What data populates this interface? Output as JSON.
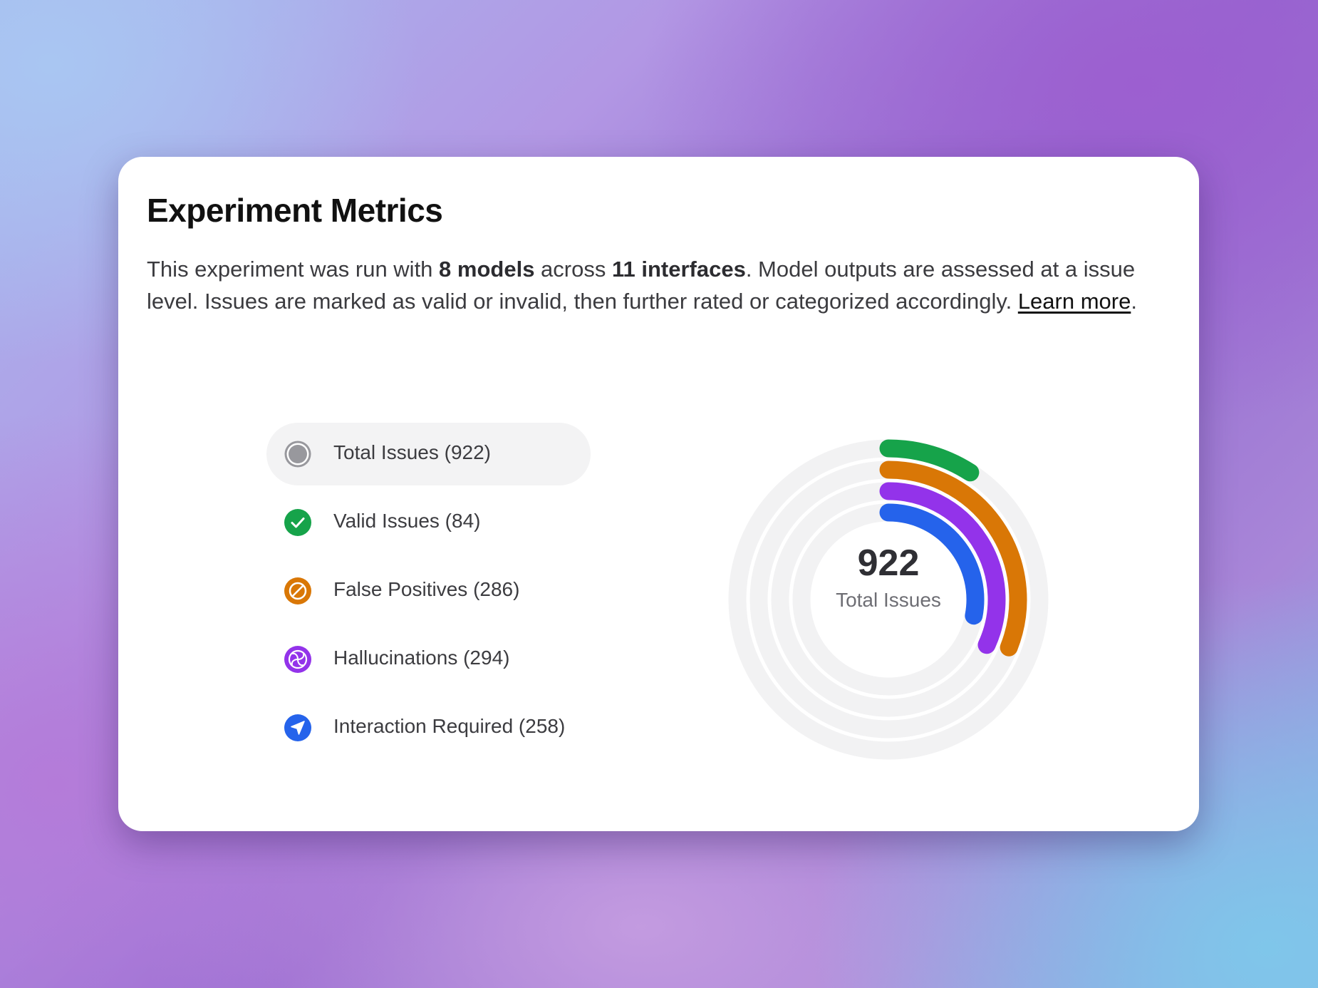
{
  "card": {
    "title": "Experiment Metrics",
    "desc_1": "This experiment was run with ",
    "desc_models": "8 models",
    "desc_2": " across ",
    "desc_interfaces": "11 interfaces",
    "desc_3": ". Model outputs are assessed at a issue level. Issues are marked as valid or invalid, then further rated or categorized accordingly. ",
    "learn_more": "Learn more",
    "desc_end": "."
  },
  "legend": [
    {
      "label": "Total Issues (922)",
      "icon": "circle-icon",
      "color": "#98989d",
      "active": true
    },
    {
      "label": "Valid Issues (84)",
      "icon": "checkmark-icon",
      "color": "#16a34a"
    },
    {
      "label": "False Positives (286)",
      "icon": "slash-circle-icon",
      "color": "#d97706"
    },
    {
      "label": "Hallucinations (294)",
      "icon": "pinwheel-icon",
      "color": "#9333ea"
    },
    {
      "label": "Interaction Required (258)",
      "icon": "navigation-arrow-icon",
      "color": "#2563eb"
    }
  ],
  "chart": {
    "center_value": "922",
    "center_label": "Total Issues"
  },
  "chart_data": {
    "type": "radial-bar",
    "total": 922,
    "series": [
      {
        "name": "Valid Issues",
        "value": 84,
        "color": "#16a34a"
      },
      {
        "name": "False Positives",
        "value": 286,
        "color": "#d97706"
      },
      {
        "name": "Hallucinations",
        "value": 294,
        "color": "#9333ea"
      },
      {
        "name": "Interaction Required",
        "value": 258,
        "color": "#2563eb"
      }
    ]
  }
}
